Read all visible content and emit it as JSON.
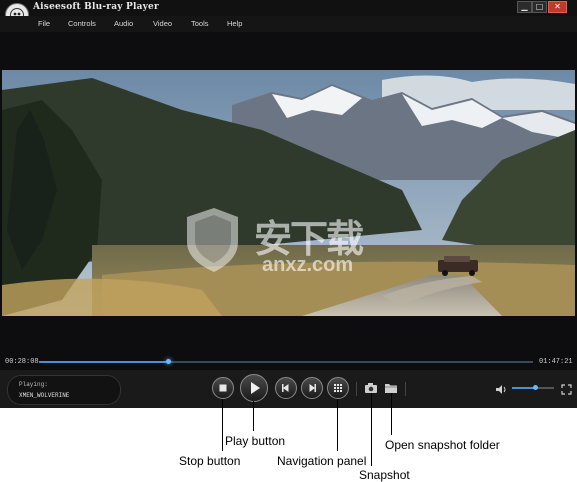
{
  "window": {
    "title": "Aiseesoft Blu-ray Player",
    "minimize_glyph": "▁",
    "maximize_glyph": "□",
    "close_glyph": "✕"
  },
  "menu": [
    "File",
    "Controls",
    "Audio",
    "Video",
    "Tools",
    "Help"
  ],
  "watermark": {
    "text": "安下载",
    "subtext": "anxz.com"
  },
  "playback": {
    "elapsed": "00:28:08",
    "total": "01:47:21",
    "progress": 0.262
  },
  "status": {
    "label": "Playing:",
    "file": "XMEN_WOLVERINE"
  },
  "volume": {
    "level": 0.55
  },
  "icons": {
    "stop": "stop-icon",
    "play": "play-icon",
    "previous": "previous-chapter-icon",
    "next": "next-chapter-icon",
    "navigation": "navigation-grid-icon",
    "snapshot": "camera-icon",
    "folder": "folder-icon",
    "volume": "speaker-icon",
    "fullscreen": "fullscreen-icon"
  },
  "annotations": {
    "play": "Play button",
    "stop": "Stop button",
    "navigation": "Navigation panel",
    "snapshot": "Snapshot",
    "open_folder": "Open snapshot folder"
  }
}
